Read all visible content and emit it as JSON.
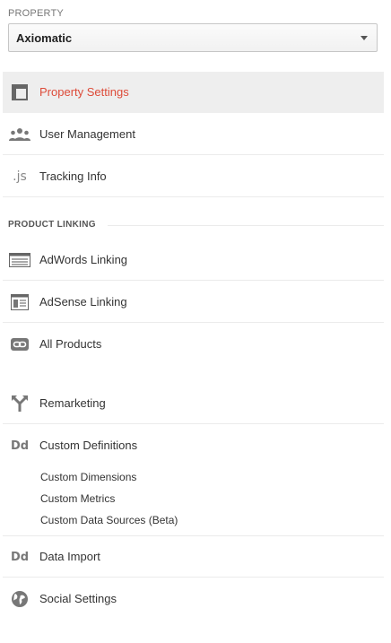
{
  "property": {
    "label": "PROPERTY",
    "selected": "Axiomatic"
  },
  "nav": {
    "property_settings": {
      "label": "Property Settings",
      "icon": "property-settings-icon"
    },
    "user_management": {
      "label": "User Management",
      "icon": "users-icon"
    },
    "tracking_info": {
      "label": "Tracking Info",
      "icon_text": ".js"
    }
  },
  "product_linking": {
    "header": "PRODUCT LINKING",
    "adwords": "AdWords Linking",
    "adsense": "AdSense Linking",
    "all_products": "All Products"
  },
  "more": {
    "remarketing": "Remarketing",
    "custom_definitions": {
      "label": "Custom Definitions",
      "icon_text": "Dd",
      "children": [
        "Custom Dimensions",
        "Custom Metrics",
        "Custom Data Sources (Beta)"
      ]
    },
    "data_import": {
      "label": "Data Import",
      "icon_text": "Dd"
    },
    "social_settings": "Social Settings"
  },
  "colors": {
    "active_text": "#dd4b39",
    "active_bg": "#eeeeee",
    "icon_gray": "#777777"
  }
}
